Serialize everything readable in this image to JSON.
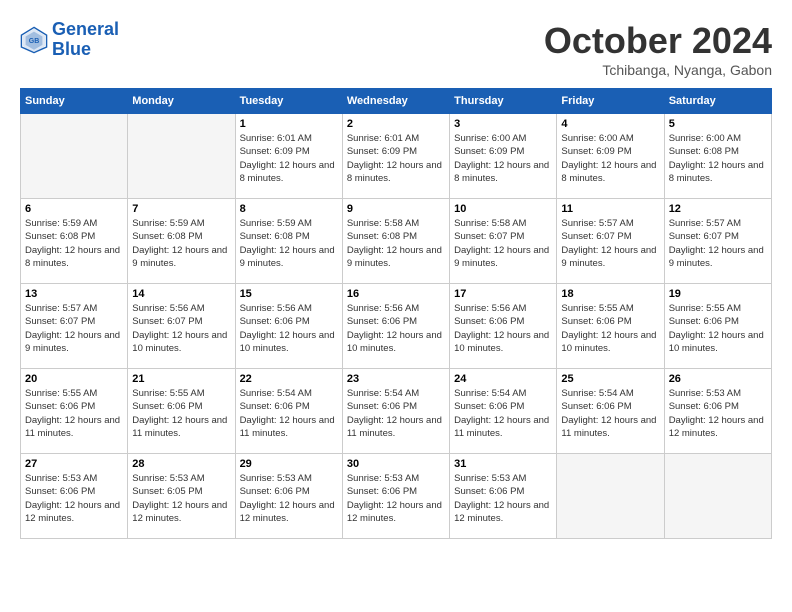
{
  "logo": {
    "line1": "General",
    "line2": "Blue"
  },
  "title": "October 2024",
  "location": "Tchibanga, Nyanga, Gabon",
  "days_of_week": [
    "Sunday",
    "Monday",
    "Tuesday",
    "Wednesday",
    "Thursday",
    "Friday",
    "Saturday"
  ],
  "weeks": [
    [
      {
        "day": "",
        "empty": true
      },
      {
        "day": "",
        "empty": true
      },
      {
        "day": "1",
        "sunrise": "6:01 AM",
        "sunset": "6:09 PM",
        "daylight": "12 hours and 8 minutes."
      },
      {
        "day": "2",
        "sunrise": "6:01 AM",
        "sunset": "6:09 PM",
        "daylight": "12 hours and 8 minutes."
      },
      {
        "day": "3",
        "sunrise": "6:00 AM",
        "sunset": "6:09 PM",
        "daylight": "12 hours and 8 minutes."
      },
      {
        "day": "4",
        "sunrise": "6:00 AM",
        "sunset": "6:09 PM",
        "daylight": "12 hours and 8 minutes."
      },
      {
        "day": "5",
        "sunrise": "6:00 AM",
        "sunset": "6:08 PM",
        "daylight": "12 hours and 8 minutes."
      }
    ],
    [
      {
        "day": "6",
        "sunrise": "5:59 AM",
        "sunset": "6:08 PM",
        "daylight": "12 hours and 8 minutes."
      },
      {
        "day": "7",
        "sunrise": "5:59 AM",
        "sunset": "6:08 PM",
        "daylight": "12 hours and 9 minutes."
      },
      {
        "day": "8",
        "sunrise": "5:59 AM",
        "sunset": "6:08 PM",
        "daylight": "12 hours and 9 minutes."
      },
      {
        "day": "9",
        "sunrise": "5:58 AM",
        "sunset": "6:08 PM",
        "daylight": "12 hours and 9 minutes."
      },
      {
        "day": "10",
        "sunrise": "5:58 AM",
        "sunset": "6:07 PM",
        "daylight": "12 hours and 9 minutes."
      },
      {
        "day": "11",
        "sunrise": "5:57 AM",
        "sunset": "6:07 PM",
        "daylight": "12 hours and 9 minutes."
      },
      {
        "day": "12",
        "sunrise": "5:57 AM",
        "sunset": "6:07 PM",
        "daylight": "12 hours and 9 minutes."
      }
    ],
    [
      {
        "day": "13",
        "sunrise": "5:57 AM",
        "sunset": "6:07 PM",
        "daylight": "12 hours and 9 minutes."
      },
      {
        "day": "14",
        "sunrise": "5:56 AM",
        "sunset": "6:07 PM",
        "daylight": "12 hours and 10 minutes."
      },
      {
        "day": "15",
        "sunrise": "5:56 AM",
        "sunset": "6:06 PM",
        "daylight": "12 hours and 10 minutes."
      },
      {
        "day": "16",
        "sunrise": "5:56 AM",
        "sunset": "6:06 PM",
        "daylight": "12 hours and 10 minutes."
      },
      {
        "day": "17",
        "sunrise": "5:56 AM",
        "sunset": "6:06 PM",
        "daylight": "12 hours and 10 minutes."
      },
      {
        "day": "18",
        "sunrise": "5:55 AM",
        "sunset": "6:06 PM",
        "daylight": "12 hours and 10 minutes."
      },
      {
        "day": "19",
        "sunrise": "5:55 AM",
        "sunset": "6:06 PM",
        "daylight": "12 hours and 10 minutes."
      }
    ],
    [
      {
        "day": "20",
        "sunrise": "5:55 AM",
        "sunset": "6:06 PM",
        "daylight": "12 hours and 11 minutes."
      },
      {
        "day": "21",
        "sunrise": "5:55 AM",
        "sunset": "6:06 PM",
        "daylight": "12 hours and 11 minutes."
      },
      {
        "day": "22",
        "sunrise": "5:54 AM",
        "sunset": "6:06 PM",
        "daylight": "12 hours and 11 minutes."
      },
      {
        "day": "23",
        "sunrise": "5:54 AM",
        "sunset": "6:06 PM",
        "daylight": "12 hours and 11 minutes."
      },
      {
        "day": "24",
        "sunrise": "5:54 AM",
        "sunset": "6:06 PM",
        "daylight": "12 hours and 11 minutes."
      },
      {
        "day": "25",
        "sunrise": "5:54 AM",
        "sunset": "6:06 PM",
        "daylight": "12 hours and 11 minutes."
      },
      {
        "day": "26",
        "sunrise": "5:53 AM",
        "sunset": "6:06 PM",
        "daylight": "12 hours and 12 minutes."
      }
    ],
    [
      {
        "day": "27",
        "sunrise": "5:53 AM",
        "sunset": "6:06 PM",
        "daylight": "12 hours and 12 minutes."
      },
      {
        "day": "28",
        "sunrise": "5:53 AM",
        "sunset": "6:05 PM",
        "daylight": "12 hours and 12 minutes."
      },
      {
        "day": "29",
        "sunrise": "5:53 AM",
        "sunset": "6:06 PM",
        "daylight": "12 hours and 12 minutes."
      },
      {
        "day": "30",
        "sunrise": "5:53 AM",
        "sunset": "6:06 PM",
        "daylight": "12 hours and 12 minutes."
      },
      {
        "day": "31",
        "sunrise": "5:53 AM",
        "sunset": "6:06 PM",
        "daylight": "12 hours and 12 minutes."
      },
      {
        "day": "",
        "empty": true
      },
      {
        "day": "",
        "empty": true
      }
    ]
  ]
}
